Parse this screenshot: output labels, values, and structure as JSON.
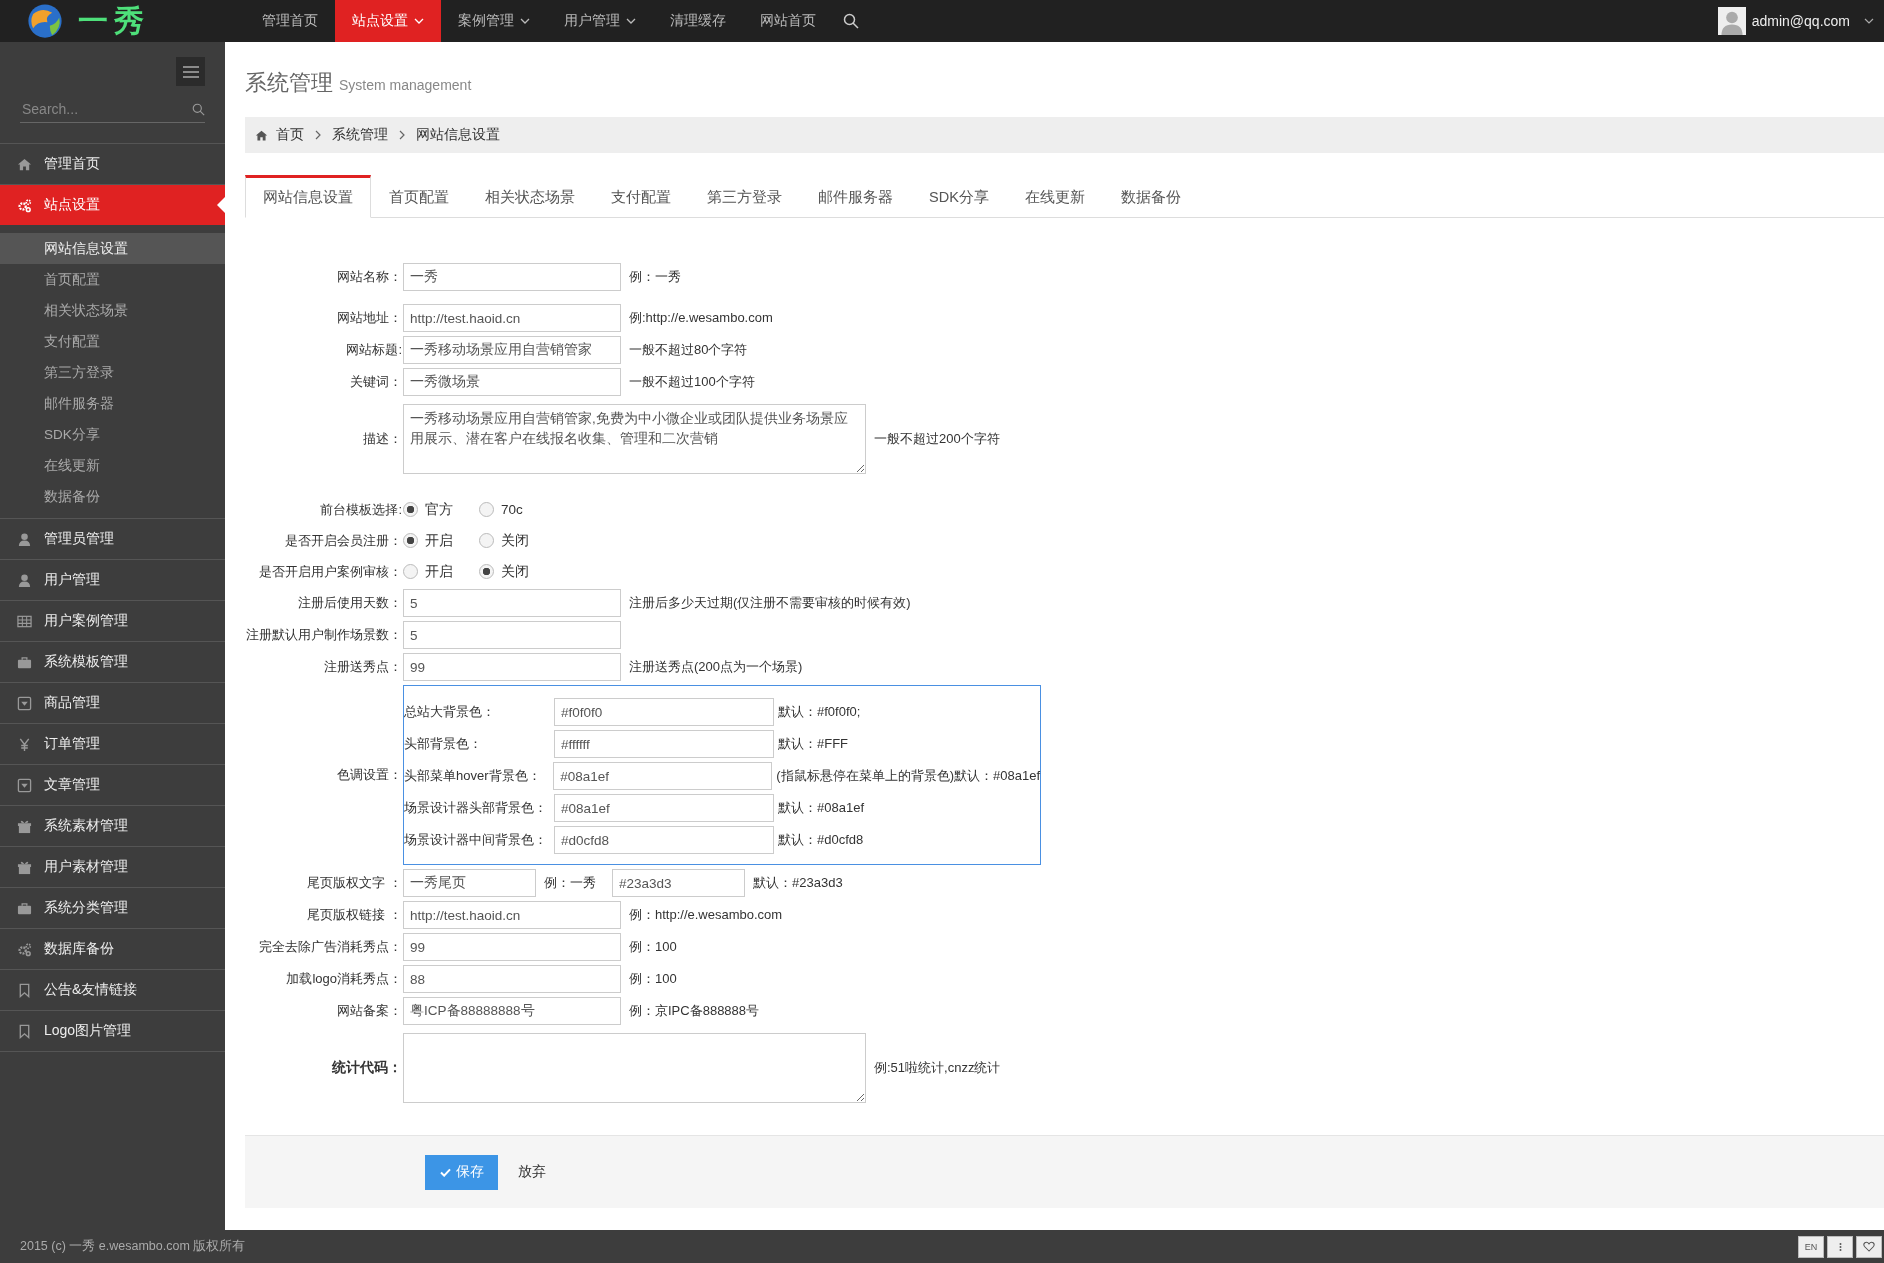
{
  "logo": {
    "text": "一秀"
  },
  "top_nav": [
    {
      "label": "管理首页",
      "selected": false,
      "dropdown": false
    },
    {
      "label": "站点设置",
      "selected": true,
      "dropdown": true
    },
    {
      "label": "案例管理",
      "selected": false,
      "dropdown": true
    },
    {
      "label": "用户管理",
      "selected": false,
      "dropdown": true
    },
    {
      "label": "清理缓存",
      "selected": false,
      "dropdown": false
    },
    {
      "label": "网站首页",
      "selected": false,
      "dropdown": false
    }
  ],
  "user": {
    "email": "admin@qq.com"
  },
  "sidebar": {
    "search": {
      "placeholder": "Search..."
    },
    "items": [
      {
        "label": "管理首页",
        "selected": false
      },
      {
        "label": "站点设置",
        "selected": true,
        "children": [
          {
            "label": "网站信息设置",
            "selected": true
          },
          {
            "label": "首页配置",
            "selected": false
          },
          {
            "label": "相关状态场景",
            "selected": false
          },
          {
            "label": "支付配置",
            "selected": false
          },
          {
            "label": "第三方登录",
            "selected": false
          },
          {
            "label": "邮件服务器",
            "selected": false
          },
          {
            "label": "SDK分享",
            "selected": false
          },
          {
            "label": "在线更新",
            "selected": false
          },
          {
            "label": "数据备份",
            "selected": false
          }
        ]
      },
      {
        "label": "管理员管理",
        "selected": false
      },
      {
        "label": "用户管理",
        "selected": false
      },
      {
        "label": "用户案例管理",
        "selected": false
      },
      {
        "label": "系统模板管理",
        "selected": false
      },
      {
        "label": "商品管理",
        "selected": false
      },
      {
        "label": "订单管理",
        "selected": false
      },
      {
        "label": "文章管理",
        "selected": false
      },
      {
        "label": "系统素材管理",
        "selected": false
      },
      {
        "label": "用户素材管理",
        "selected": false
      },
      {
        "label": "系统分类管理",
        "selected": false
      },
      {
        "label": "数据库备份",
        "selected": false
      },
      {
        "label": "公告&友情链接",
        "selected": false
      },
      {
        "label": "Logo图片管理",
        "selected": false
      }
    ]
  },
  "page_header": {
    "title": "系统管理",
    "subtitle": "System management"
  },
  "breadcrumb": [
    "首页",
    "系统管理",
    "网站信息设置"
  ],
  "tabs": [
    {
      "label": "网站信息设置",
      "selected": true
    },
    {
      "label": "首页配置",
      "selected": false
    },
    {
      "label": "相关状态场景",
      "selected": false
    },
    {
      "label": "支付配置",
      "selected": false
    },
    {
      "label": "第三方登录",
      "selected": false
    },
    {
      "label": "邮件服务器",
      "selected": false
    },
    {
      "label": "SDK分享",
      "selected": false
    },
    {
      "label": "在线更新",
      "selected": false
    },
    {
      "label": "数据备份",
      "selected": false
    }
  ],
  "form": [
    {
      "kind": "text",
      "label": "网站名称：",
      "value": "一秀",
      "hint": "例：一秀"
    },
    {
      "kind": "text",
      "label": "网站地址：",
      "value": "http://test.haoid.cn",
      "hint": "例:http://e.wesambo.com"
    },
    {
      "kind": "text",
      "label": "网站标题:",
      "value": "一秀移动场景应用自营销管家",
      "hint": "一般不超过80个字符"
    },
    {
      "kind": "text",
      "label": "关键词：",
      "value": "一秀微场景",
      "hint": "一般不超过100个字符"
    },
    {
      "kind": "textarea",
      "label": "描述：",
      "value": "一秀移动场景应用自营销管家,免费为中小微企业或团队提供业务场景应用展示、潜在客户在线报名收集、管理和二次营销",
      "hint": "一般不超过200个字符"
    },
    {
      "kind": "radio",
      "label": "前台模板选择:",
      "options": [
        {
          "label": "官方",
          "selected": true
        },
        {
          "label": "70c",
          "selected": false
        }
      ]
    },
    {
      "kind": "radio",
      "label": "是否开启会员注册：",
      "options": [
        {
          "label": "开启",
          "selected": true
        },
        {
          "label": "关闭",
          "selected": false
        }
      ]
    },
    {
      "kind": "radio",
      "label": "是否开启用户案例审核：",
      "options": [
        {
          "label": "开启",
          "selected": false
        },
        {
          "label": "关闭",
          "selected": true
        }
      ]
    },
    {
      "kind": "text",
      "label": "注册后使用天数：",
      "value": "5",
      "hint": "注册后多少天过期(仅注册不需要审核的时候有效)"
    },
    {
      "kind": "text",
      "label": "注册默认用户制作场景数：",
      "value": "5"
    },
    {
      "kind": "text",
      "label": "注册送秀点：",
      "value": "99",
      "hint": "注册送秀点(200点为一个场景)"
    },
    {
      "kind": "colors",
      "label": "色调设置：",
      "rows": [
        {
          "label": "总站大背景色：",
          "value": "#f0f0f0",
          "hint": "默认：#f0f0f0;"
        },
        {
          "label": "头部背景色：",
          "value": "#ffffff",
          "hint": "默认：#FFF"
        },
        {
          "label": "头部菜单hover背景色：",
          "value": "#08a1ef",
          "hint": "(指鼠标悬停在菜单上的背景色)默认：#08a1ef"
        },
        {
          "label": "场景设计器头部背景色：",
          "value": "#08a1ef",
          "hint": "默认：#08a1ef"
        },
        {
          "label": "场景设计器中间背景色：",
          "value": "#d0cfd8",
          "hint": "默认：#d0cfd8"
        }
      ]
    },
    {
      "kind": "pair",
      "label": "尾页版权文字 ：",
      "value": "一秀尾页",
      "hint": "例：一秀",
      "value2": "#23a3d3",
      "hint2": "默认：#23a3d3"
    },
    {
      "kind": "text",
      "label": "尾页版权链接 ：",
      "value": "http://test.haoid.cn",
      "hint": "例：http://e.wesambo.com"
    },
    {
      "kind": "text",
      "label": "完全去除广告消耗秀点：",
      "value": "99",
      "hint": "例：100"
    },
    {
      "kind": "text",
      "label": "加载logo消耗秀点：",
      "value": "88",
      "hint": "例：100"
    },
    {
      "kind": "text",
      "label": "网站备案：",
      "value": "粤ICP备88888888号",
      "hint": "例：京IPC备888888号"
    },
    {
      "kind": "textarea",
      "label": "统计代码：",
      "strong": true,
      "hint": "例:51啦统计,cnzz统计"
    }
  ],
  "actions": {
    "save": "保存",
    "cancel": "放弃"
  },
  "footer": {
    "text": "2015 (c) 一秀 e.wesambo.com 版权所有",
    "language": "EN"
  }
}
